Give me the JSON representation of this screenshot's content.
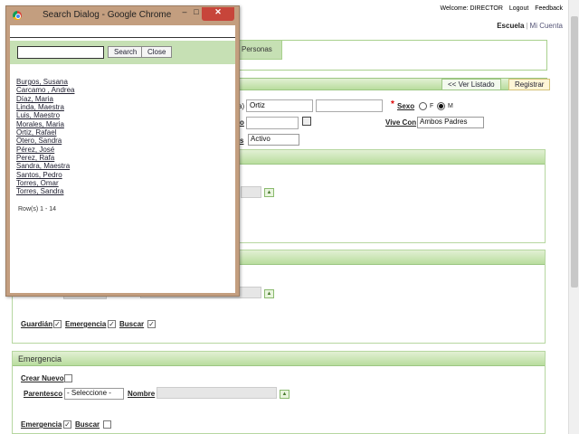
{
  "header": {
    "welcome": "Welcome: DIRECTOR",
    "logout": "Logout",
    "feedback": "Feedback",
    "nav_current": "Escuela",
    "nav_separator": "|",
    "nav_account": "Mi Cuenta"
  },
  "tabs": {
    "active": "Personas"
  },
  "toolbar": {
    "list_button": "<< Ver Listado",
    "register_button": "Registrar"
  },
  "form": {
    "lastname_label_fragment": "a)",
    "lastname_value": "Ortiz",
    "sexo_required": "*",
    "sexo_label": "Sexo",
    "sex_f": "F",
    "sex_m": "M",
    "field2_label_fragment": "o",
    "vive_con_label": "Vive Con",
    "vive_con_value": "Ambos Padres",
    "status_label_fragment": "s",
    "status_value": "Activo"
  },
  "panel2": {
    "guardian": "Guardián",
    "emergencia": "Emergencia",
    "buscar": "Buscar"
  },
  "emergency_panel": {
    "title": "Emergencia",
    "crear_nuevo": "Crear Nuevo",
    "parentesco": "Parentesco",
    "parentesco_value": "- Seleccione -",
    "nombre": "Nombre",
    "emergencia": "Emergencia",
    "buscar": "Buscar"
  },
  "popup": {
    "title": "Search Dialog - Google Chrome",
    "search_button": "Search",
    "close_button": "Close",
    "search_value": "",
    "results": [
      "Burgos, Susana",
      "Carcamo , Andrea",
      "Díaz, Maria",
      "Linda, Maestra",
      "Luis, Maestro",
      "Morales, Maria",
      "Ortiz, Rafael",
      "Otero, Sandra",
      "Pérez, José",
      "Perez, Rafa",
      "Sandra, Maestra",
      "Santos, Pedro",
      "Torres, Omar",
      "Torres, Sandra"
    ],
    "rows_label": "Row(s) 1 - 14",
    "min_icon": "minimize-icon",
    "max_icon": "maximize-icon",
    "close_icon": "close-icon"
  },
  "colors": {
    "accent_green": "#b9dd9e",
    "popup_frame": "#c39e7f",
    "close_red": "#c7453a"
  }
}
